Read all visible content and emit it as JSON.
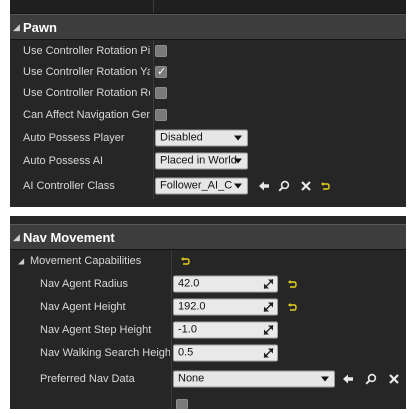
{
  "pawn": {
    "title": "Pawn",
    "rows": [
      {
        "label": "Use Controller Rotation Pitch",
        "checked": false
      },
      {
        "label": "Use Controller Rotation Yaw",
        "checked": true
      },
      {
        "label": "Use Controller Rotation Roll",
        "checked": false
      },
      {
        "label": "Can Affect Navigation Generation",
        "checked": false
      }
    ],
    "auto_possess_player": {
      "label": "Auto Possess Player",
      "value": "Disabled"
    },
    "auto_possess_ai": {
      "label": "Auto Possess AI",
      "value": "Placed in World"
    },
    "ai_controller_class": {
      "label": "AI Controller Class",
      "value": "Follower_AI_CON"
    }
  },
  "nav_movement": {
    "title": "Nav Movement",
    "movement_capabilities": {
      "label": "Movement Capabilities"
    },
    "nav_agent_radius": {
      "label": "Nav Agent Radius",
      "value": "42.0"
    },
    "nav_agent_height": {
      "label": "Nav Agent Height",
      "value": "192.0"
    },
    "nav_agent_step_height": {
      "label": "Nav Agent Step Height",
      "value": "-1.0"
    },
    "nav_walking_search_height": {
      "label": "Nav Walking Search Height",
      "value": "0.5"
    },
    "preferred_nav_data": {
      "label": "Preferred Nav Data",
      "value": "None"
    }
  },
  "colors": {
    "panel_bg": "#262626",
    "header_bg": "#3d3d3d",
    "reset_arrow": "#e6d21a",
    "field_bg": "#e6e6e6"
  },
  "icons": {
    "use_selected": "left-arrow-icon",
    "browse": "magnifier-icon",
    "clear": "x-icon",
    "reset": "reset-to-default-icon"
  }
}
